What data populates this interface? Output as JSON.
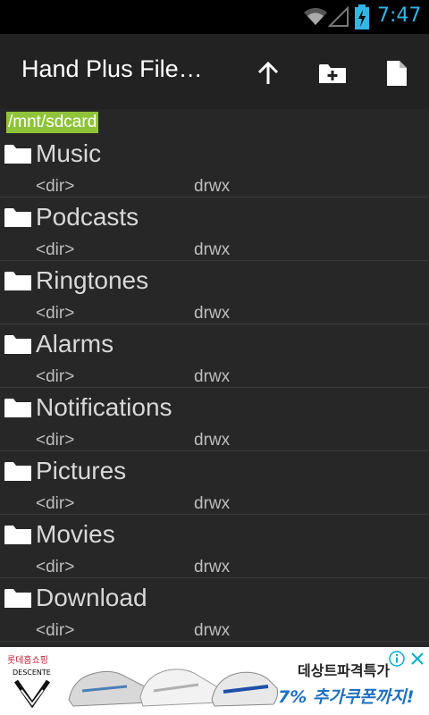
{
  "status_bar": {
    "time": "7:47",
    "clock_color": "#33b5e5"
  },
  "action_bar": {
    "title": "Hand Plus File…",
    "actions": [
      "up-arrow-icon",
      "new-folder-icon",
      "new-file-icon"
    ]
  },
  "path": {
    "current": "/mnt/sdcard",
    "highlight_color": "#8fc43a"
  },
  "files": [
    {
      "name": "Music",
      "type": "<dir>",
      "perm": "drwx"
    },
    {
      "name": "Podcasts",
      "type": "<dir>",
      "perm": "drwx"
    },
    {
      "name": "Ringtones",
      "type": "<dir>",
      "perm": "drwx"
    },
    {
      "name": "Alarms",
      "type": "<dir>",
      "perm": "drwx"
    },
    {
      "name": "Notifications",
      "type": "<dir>",
      "perm": "drwx"
    },
    {
      "name": "Pictures",
      "type": "<dir>",
      "perm": "drwx"
    },
    {
      "name": "Movies",
      "type": "<dir>",
      "perm": "drwx"
    },
    {
      "name": "Download",
      "type": "<dir>",
      "perm": "drwx"
    }
  ],
  "ad": {
    "brand_text": "롯데홈쇼핑",
    "logo_text": "DESCENTE",
    "line1": "데상트파격특가",
    "line2": "7% 추가쿠폰까지!"
  }
}
